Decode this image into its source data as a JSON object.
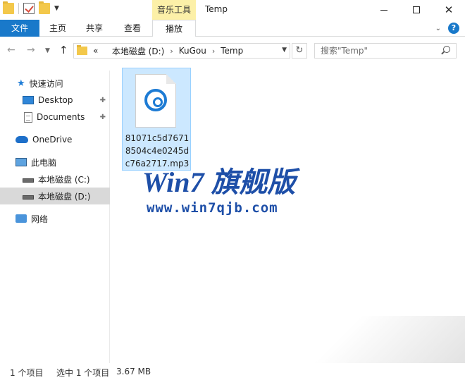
{
  "window": {
    "context_tool": "音乐工具",
    "title": "Temp"
  },
  "ribbon": {
    "tabs": [
      "文件",
      "主页",
      "共享",
      "查看",
      "播放"
    ]
  },
  "address": {
    "overflow": "«",
    "crumbs": [
      "本地磁盘 (D:)",
      "KuGou",
      "Temp"
    ]
  },
  "search": {
    "placeholder": "搜索\"Temp\""
  },
  "sidebar": {
    "items": [
      {
        "label": "快速访问"
      },
      {
        "label": "Desktop"
      },
      {
        "label": "Documents"
      },
      {
        "label": "OneDrive"
      },
      {
        "label": "此电脑"
      },
      {
        "label": "本地磁盘 (C:)"
      },
      {
        "label": "本地磁盘 (D:)"
      },
      {
        "label": "网络"
      }
    ]
  },
  "file": {
    "name": "81071c5d76718504c4e0245dc76a2717.mp3"
  },
  "watermark": {
    "title": "Win7 旗舰版",
    "url": "www.win7qjb.com"
  },
  "status": {
    "count": "1 个项目",
    "selected": "选中 1 个项目",
    "size": "3.67 MB"
  },
  "colors": {
    "accent": "#1979ca",
    "context_tab": "#fcf0a8",
    "selection": "#cce8ff",
    "watermark": "#1e4fa8"
  }
}
